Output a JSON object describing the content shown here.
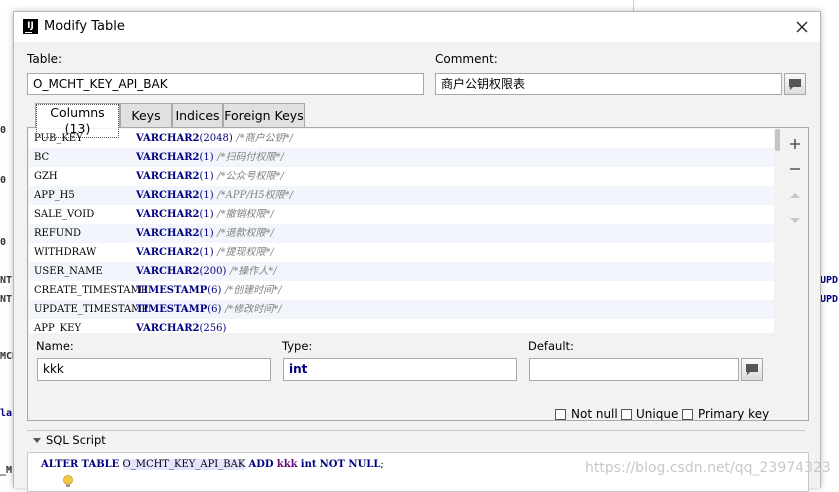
{
  "background": {
    "left_fragments": [
      "NT",
      "NT",
      "MCH",
      "la",
      "_M"
    ],
    "right_fragments": [
      "UPD",
      "UPD"
    ]
  },
  "dialog": {
    "title": "Modify Table",
    "table_label": "Table:",
    "table_value": "O_MCHT_KEY_API_BAK",
    "comment_label": "Comment:",
    "comment_value": "商户公钥权限表",
    "tabs": [
      {
        "label": "Columns (13)",
        "active": true
      },
      {
        "label": "Keys",
        "active": false
      },
      {
        "label": "Indices",
        "active": false
      },
      {
        "label": "Foreign Keys",
        "active": false
      }
    ],
    "columns": [
      {
        "name": "PUB_KEY",
        "type": "VARCHAR2",
        "size": "(2048)",
        "comment": "/*商户公钥*/"
      },
      {
        "name": "BC",
        "type": "VARCHAR2",
        "size": "(1)",
        "comment": "/*扫码付权限*/"
      },
      {
        "name": "GZH",
        "type": "VARCHAR2",
        "size": "(1)",
        "comment": "/*公众号权限*/"
      },
      {
        "name": "APP_H5",
        "type": "VARCHAR2",
        "size": "(1)",
        "comment": "/*APP/H5权限*/"
      },
      {
        "name": "SALE_VOID",
        "type": "VARCHAR2",
        "size": "(1)",
        "comment": "/*撤销权限*/"
      },
      {
        "name": "REFUND",
        "type": "VARCHAR2",
        "size": "(1)",
        "comment": "/*退款权限*/"
      },
      {
        "name": "WITHDRAW",
        "type": "VARCHAR2",
        "size": "(1)",
        "comment": "/*提现权限*/"
      },
      {
        "name": "USER_NAME",
        "type": "VARCHAR2",
        "size": "(200)",
        "comment": "/*操作人*/"
      },
      {
        "name": "CREATE_TIMESTAMP",
        "type": "TIMESTAMP",
        "size": "(6)",
        "comment": "/*创建时间*/"
      },
      {
        "name": "UPDATE_TIMESTAMP",
        "type": "TIMESTAMP",
        "size": "(6)",
        "comment": "/*修改时间*/"
      },
      {
        "name": "APP_KEY",
        "type": "VARCHAR2",
        "size": "(256)",
        "comment": ""
      }
    ],
    "column_editor": {
      "name_label": "Name:",
      "name_value": "kkk",
      "type_label": "Type:",
      "type_value": "int",
      "default_label": "Default:",
      "default_value": "",
      "not_null_label": "Not null",
      "unique_label": "Unique",
      "primary_key_label": "Primary key"
    },
    "sql_script_label": "SQL Script",
    "sql": {
      "kw1": "ALTER",
      "kw2": "TABLE",
      "table": "O_MCHT_KEY_API_BAK",
      "kw3": "ADD",
      "column": "kkk",
      "type": "int",
      "kw4": "NOT NULL",
      "end": ";"
    }
  },
  "watermark": "https://blog.csdn.net/qq_23974323",
  "colors": {
    "keyword": "#000080",
    "comment": "#808080",
    "dialog_bg": "#f2f2f2"
  }
}
